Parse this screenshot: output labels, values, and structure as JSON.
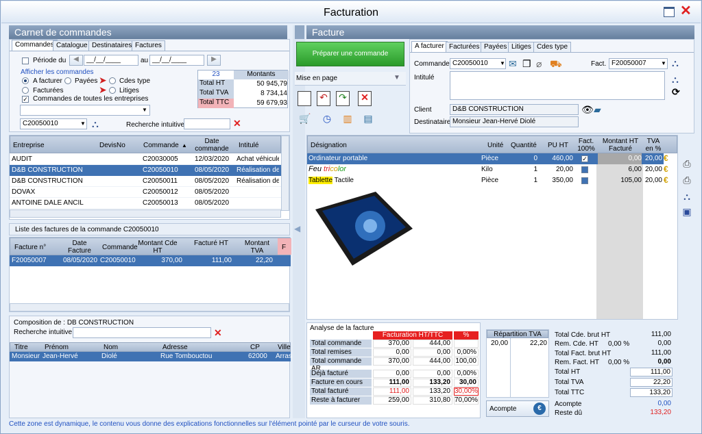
{
  "window": {
    "title": "Facturation"
  },
  "left_panel": {
    "header": "Carnet de commandes",
    "tabs": [
      "Commandes",
      "Catalogue",
      "Destinataires",
      "Factures"
    ],
    "period_label": "Période du",
    "period_from": "__/__/____",
    "period_to": "__/__/____",
    "au": "au",
    "show_label": "Afficher les commandes",
    "radios": [
      "A facturer",
      "Payées",
      "Cdes type",
      "Facturées",
      "Litiges"
    ],
    "all_companies": "Commandes de toutes les entreprises",
    "select_value": "",
    "order_value": "C20050010",
    "search_label": "Recherche intuitive",
    "totals": {
      "count": "23",
      "header": "Montants",
      "rows": [
        [
          "Total HT",
          "50 945,79"
        ],
        [
          "Total TVA",
          "8 734,14"
        ],
        [
          "Total TTC",
          "59 679,93"
        ]
      ]
    }
  },
  "orders_table": {
    "columns": [
      "Entreprise",
      "DevisNo",
      "Commande",
      "Date commande",
      "Intitulé"
    ],
    "rows": [
      [
        "AUDIT",
        "",
        "C20030005",
        "12/03/2020",
        "Achat véhicule"
      ],
      [
        "D&B CONSTRUCTION",
        "",
        "C20050010",
        "08/05/2020",
        "Réalisation de vo"
      ],
      [
        "D&B CONSTRUCTION",
        "",
        "C20050011",
        "08/05/2020",
        "Réalisation de vo"
      ],
      [
        "DOVAX",
        "",
        "C20050012",
        "08/05/2020",
        ""
      ],
      [
        "ANTOINE DALE ANCIL",
        "",
        "C20050013",
        "08/05/2020",
        ""
      ]
    ]
  },
  "invoices_list": {
    "header": "Liste des factures de la commande C20050010",
    "columns": [
      "Facture n°",
      "Date Facture",
      "Commande",
      "Montant Cde HT",
      "Facturé HT",
      "Montant TVA",
      "F"
    ],
    "rows": [
      [
        "F20050007",
        "08/05/2020",
        "C20050010",
        "370,00",
        "111,00",
        "22,20"
      ]
    ]
  },
  "composition": {
    "header": "Composition de : DB CONSTRUCTION",
    "search_label": "Recherche intuitive",
    "columns": [
      "Titre",
      "Prénom",
      "Nom",
      "Adresse",
      "CP",
      "Ville"
    ],
    "rows": [
      [
        "Monsieur",
        "Jean-Hervé",
        "Diolé",
        "Rue Tombouctou",
        "62000",
        "Arras"
      ]
    ]
  },
  "middle": {
    "prepare_btn": "Préparer une commande",
    "layout_label": "Mise en page"
  },
  "right_panel": {
    "header": "Facture",
    "tabs": [
      "A facturer",
      "Facturées",
      "Payées",
      "Litiges",
      "Cdes type"
    ],
    "commande_label": "Commande",
    "commande_value": "C20050010",
    "fact_label": "Fact.",
    "fact_value": "F20050007",
    "intitule_label": "Intitulé",
    "client_label": "Client",
    "client_value": "D&B CONSTRUCTION",
    "dest_label": "Destinataire",
    "dest_value": "Monsieur Jean-Hervé Diolé"
  },
  "lines_table": {
    "columns": [
      "Désignation",
      "Unité",
      "Quantité",
      "PU HT",
      "Fact. 100%",
      "Montant HT Facturé",
      "TVA en %"
    ],
    "rows": [
      [
        "Ordinateur portable",
        "Pièce",
        "0",
        "460,00",
        "",
        "0,00",
        "20,00"
      ],
      [
        "Feu tricolor",
        "Kilo",
        "1",
        "20,00",
        "",
        "6,00",
        "20,00"
      ],
      [
        "Tablette Tactile",
        "Pièce",
        "1",
        "350,00",
        "",
        "105,00",
        "20,00"
      ]
    ],
    "feu_parts": [
      "Feu ",
      "tri",
      "co",
      "lor"
    ],
    "tab_parts": [
      "Tablette",
      "Tactile"
    ]
  },
  "analysis": {
    "title": "Analyse de la facture",
    "head": [
      "Facturation HT/TTC",
      "%"
    ],
    "rows": [
      [
        "Total commande",
        "370,00",
        "444,00",
        ""
      ],
      [
        "Total remises",
        "0,00",
        "0,00",
        "0,00%"
      ],
      [
        "Total commande AR",
        "370,00",
        "444,00",
        "100,00"
      ],
      [
        "Déjà facturé",
        "0,00",
        "0,00",
        "0,00%"
      ],
      [
        "Facture en cours",
        "111,00",
        "133,20",
        "30,00"
      ],
      [
        "Total facturé",
        "111,00",
        "133,20",
        "30,00%"
      ],
      [
        "Reste à facturer",
        "259,00",
        "310,80",
        "70,00%"
      ]
    ]
  },
  "tva": {
    "header": "Répartition TVA",
    "rows": [
      [
        "20,00",
        "22,20"
      ]
    ],
    "acompte_btn": "Acompte"
  },
  "summary": {
    "rows": [
      [
        "Total Cde. brut HT",
        "",
        "111,00"
      ],
      [
        "Rem. Cde. HT",
        "0,00 %",
        "0,00"
      ],
      [
        "Total Fact. brut HT",
        "",
        "111,00"
      ],
      [
        "Rem. Fact. HT",
        "0,00 %",
        "0,00"
      ],
      [
        "Total HT",
        "",
        "111,00"
      ],
      [
        "Total TVA",
        "",
        "22,20"
      ],
      [
        "Total TTC",
        "",
        "133,20"
      ],
      [
        "Acompte",
        "",
        "0,00"
      ],
      [
        "Reste dû",
        "",
        "133,20"
      ]
    ]
  },
  "status": "Cette zone est dynamique, le contenu vous donne des explications fonctionnelles sur l'élément pointé par le curseur de votre souris.",
  "colors": {
    "header": "#7891b0",
    "selection": "#3f72b3",
    "green_btn": "#3daa3d",
    "accent_red": "#e62020",
    "link_blue": "#2050c0"
  }
}
